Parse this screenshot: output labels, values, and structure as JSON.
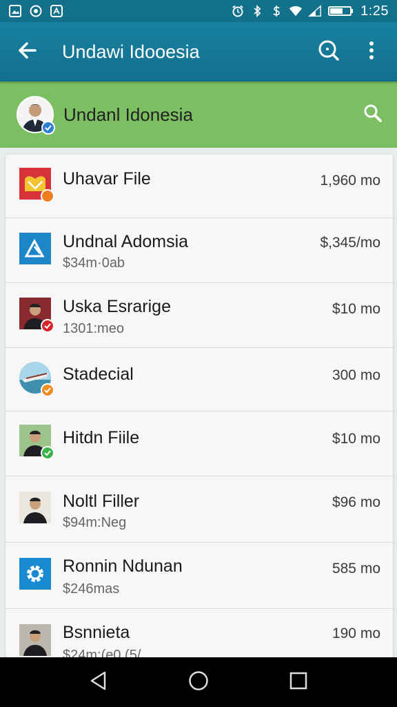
{
  "status_bar": {
    "time": "1:25",
    "icons": [
      "gallery-icon",
      "circle-notification-icon",
      "translate-icon",
      "alarm-icon",
      "bluetooth-icon",
      "dollar-icon",
      "wifi-icon",
      "signal-icon",
      "battery-icon"
    ]
  },
  "app_bar": {
    "title": "Undawi Idooesia",
    "back_icon": "back-arrow-icon",
    "search_icon": "search-icon",
    "menu_icon": "more-vert-icon",
    "color": "#1781a0"
  },
  "header": {
    "title": "Undanl Idonesia",
    "search_icon": "search-icon",
    "color": "#7cbf62"
  },
  "list": [
    {
      "title": "Uhavar File",
      "subtitle": "",
      "price": "1,960 mo",
      "icon": "red-document-icon",
      "badge": "orange"
    },
    {
      "title": "Undnal Adomsia",
      "subtitle": "$34m·0ab",
      "price": "$,345/mo",
      "icon": "blue-app-icon",
      "badge": ""
    },
    {
      "title": "Uska Esrarige",
      "subtitle": "1301:meo",
      "price": "$10 mo",
      "icon": "person-photo-icon",
      "badge": "red"
    },
    {
      "title": "Stadecial",
      "subtitle": "",
      "price": "300 mo",
      "icon": "boat-photo-icon",
      "badge": "orange"
    },
    {
      "title": "Hitdn Fiile",
      "subtitle": "",
      "price": "$10 mo",
      "icon": "person-photo-icon",
      "badge": "green"
    },
    {
      "title": "Noltl Filler",
      "subtitle": "$94m:Neg",
      "price": "$96 mo",
      "icon": "person-photo-icon",
      "badge": ""
    },
    {
      "title": "Ronnin Ndunan",
      "subtitle": "$246mas",
      "price": "585 mo",
      "icon": "gear-app-icon",
      "badge": ""
    },
    {
      "title": "Bsnnieta",
      "subtitle": "$24m:(e0 (5/",
      "price": "190 mo",
      "icon": "person-photo-icon",
      "badge": ""
    }
  ],
  "nav_bar": {
    "buttons": [
      "back-triangle-icon",
      "home-circle-icon",
      "recents-square-icon"
    ]
  }
}
